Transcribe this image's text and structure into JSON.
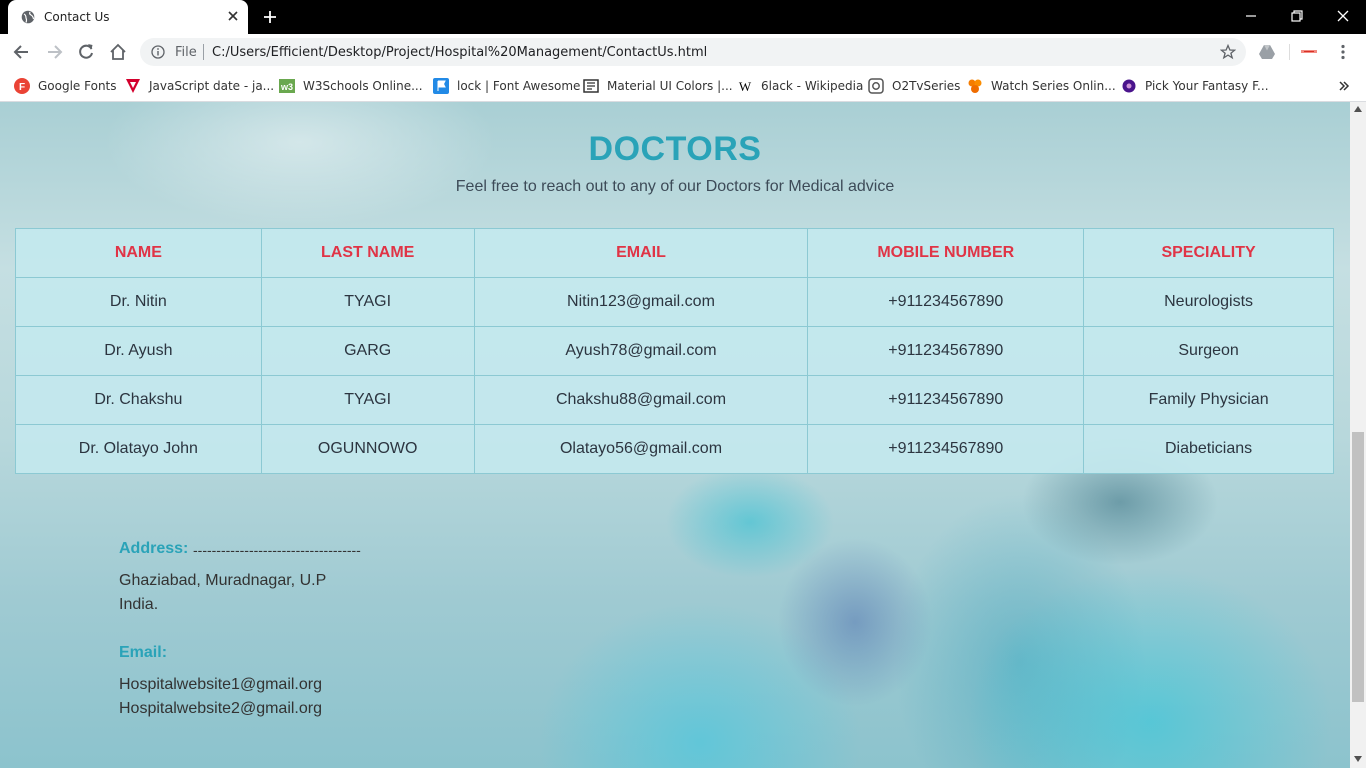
{
  "browser": {
    "tab_title": "Contact Us",
    "scheme_label": "File",
    "url": "C:/Users/Efficient/Desktop/Project/Hospital%20Management/ContactUs.html",
    "bookmarks": [
      {
        "label": "Google Fonts",
        "icon": "google-fonts-icon",
        "color": "#ea4335"
      },
      {
        "label": "JavaScript date - ja...",
        "icon": "javascript-icon",
        "color": "#d3002d"
      },
      {
        "label": "W3Schools Online...",
        "icon": "w3schools-icon",
        "color": "#6aa84f"
      },
      {
        "label": "lock | Font Awesome",
        "icon": "font-awesome-icon",
        "color": "#228ae6"
      },
      {
        "label": "Material UI Colors |...",
        "icon": "material-ui-icon",
        "color": "#333333"
      },
      {
        "label": "6lack - Wikipedia",
        "icon": "wikipedia-icon",
        "color": "#000000"
      },
      {
        "label": "O2TvSeries",
        "icon": "o2tvseries-icon",
        "color": "#555555"
      },
      {
        "label": "Watch Series Onlin...",
        "icon": "watch-series-icon",
        "color": "#f57c00"
      },
      {
        "label": "Pick Your Fantasy F...",
        "icon": "fantasy-icon",
        "color": "#4a148c"
      }
    ]
  },
  "page": {
    "heading": "DOCTORS",
    "subheading": "Feel free to reach out to any of our Doctors for Medical advice",
    "table": {
      "headers": [
        "NAME",
        "LAST NAME",
        "EMAIL",
        "MOBILE NUMBER",
        "SPECIALITY"
      ],
      "rows": [
        [
          "Dr. Nitin",
          "TYAGI",
          "Nitin123@gmail.com",
          "+911234567890",
          "Neurologists"
        ],
        [
          "Dr. Ayush",
          "GARG",
          "Ayush78@gmail.com",
          "+911234567890",
          "Surgeon"
        ],
        [
          "Dr. Chakshu",
          "TYAGI",
          "Chakshu88@gmail.com",
          "+911234567890",
          "Family Physician"
        ],
        [
          "Dr. Olatayo John",
          "OGUNNOWO",
          "Olatayo56@gmail.com",
          "+911234567890",
          "Diabeticians"
        ]
      ]
    },
    "contact": {
      "address_label": "Address:",
      "address_dashes": "------------------------------------",
      "address_lines": [
        "Ghaziabad, Muradnagar, U.P",
        "India."
      ],
      "email_label": "Email:",
      "emails": [
        "Hospitalwebsite1@gmail.org",
        "Hospitalwebsite2@gmail.org"
      ]
    },
    "colors": {
      "accent": "#2aa3b8",
      "header_text": "#e03446",
      "table_bg": "#c3e8ee"
    }
  }
}
